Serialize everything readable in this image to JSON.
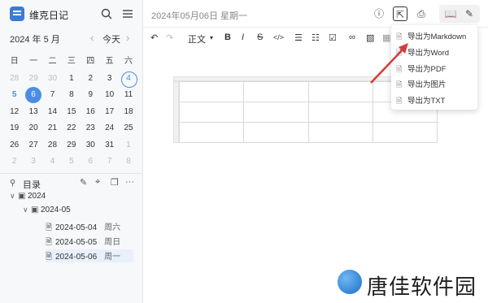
{
  "app": {
    "title": "维克日记"
  },
  "calendar": {
    "month_label": "2024 年 5 月",
    "today_label": "今天",
    "weekdays": [
      "日",
      "一",
      "二",
      "三",
      "四",
      "五",
      "六"
    ],
    "weeks": [
      [
        "28",
        "29",
        "30",
        "1",
        "2",
        "3",
        "4"
      ],
      [
        "5",
        "6",
        "7",
        "8",
        "9",
        "10",
        "11"
      ],
      [
        "12",
        "13",
        "14",
        "15",
        "16",
        "17",
        "18"
      ],
      [
        "19",
        "20",
        "21",
        "22",
        "23",
        "24",
        "25"
      ],
      [
        "26",
        "27",
        "28",
        "29",
        "30",
        "31",
        "1"
      ],
      [
        "2",
        "3",
        "4",
        "5",
        "6",
        "7",
        "8"
      ]
    ],
    "selected_day": "6"
  },
  "directory": {
    "title": "目录",
    "items": [
      {
        "label": "2024"
      },
      {
        "label": "2024-05"
      },
      {
        "label": "2024-05-04",
        "weekday": "周六"
      },
      {
        "label": "2024-05-05",
        "weekday": "周日"
      },
      {
        "label": "2024-05-06",
        "weekday": "周一"
      }
    ]
  },
  "header": {
    "date": "2024年05月06日 星期一"
  },
  "toolbar": {
    "paragraph_style": "正文"
  },
  "export_menu": {
    "items": [
      {
        "label": "导出为Markdown"
      },
      {
        "label": "导出为Word"
      },
      {
        "label": "导出为PDF"
      },
      {
        "label": "导出为图片"
      },
      {
        "label": "导出为TXT"
      }
    ]
  },
  "watermark": {
    "text": "唐佳软件园"
  },
  "colors": {
    "accent": "#4c8de4",
    "annotation_arrow": "#d93a3a"
  }
}
